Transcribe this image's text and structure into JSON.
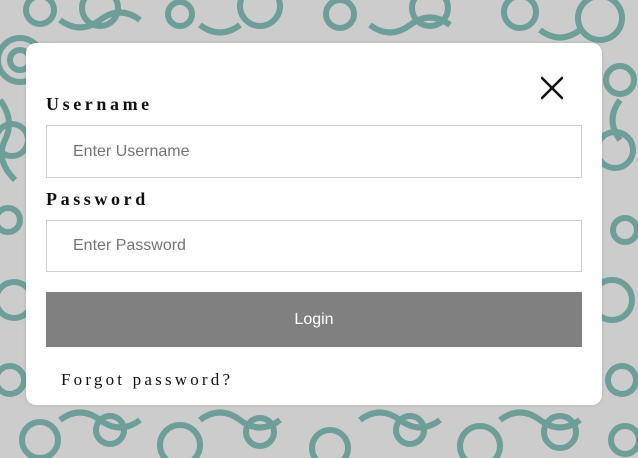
{
  "colors": {
    "background": "#c9cbca",
    "pattern": "#5e9690",
    "card": "#ffffff",
    "button": "#808080",
    "button_text": "#ffffff",
    "input_border": "#cfcfcf"
  },
  "login_modal": {
    "close_icon": "close-icon",
    "username": {
      "label": "Username",
      "value": "",
      "placeholder": "Enter Username"
    },
    "password": {
      "label": "Password",
      "value": "",
      "placeholder": "Enter Password"
    },
    "login_button_label": "Login",
    "forgot_password_link": "Forgot password?"
  }
}
